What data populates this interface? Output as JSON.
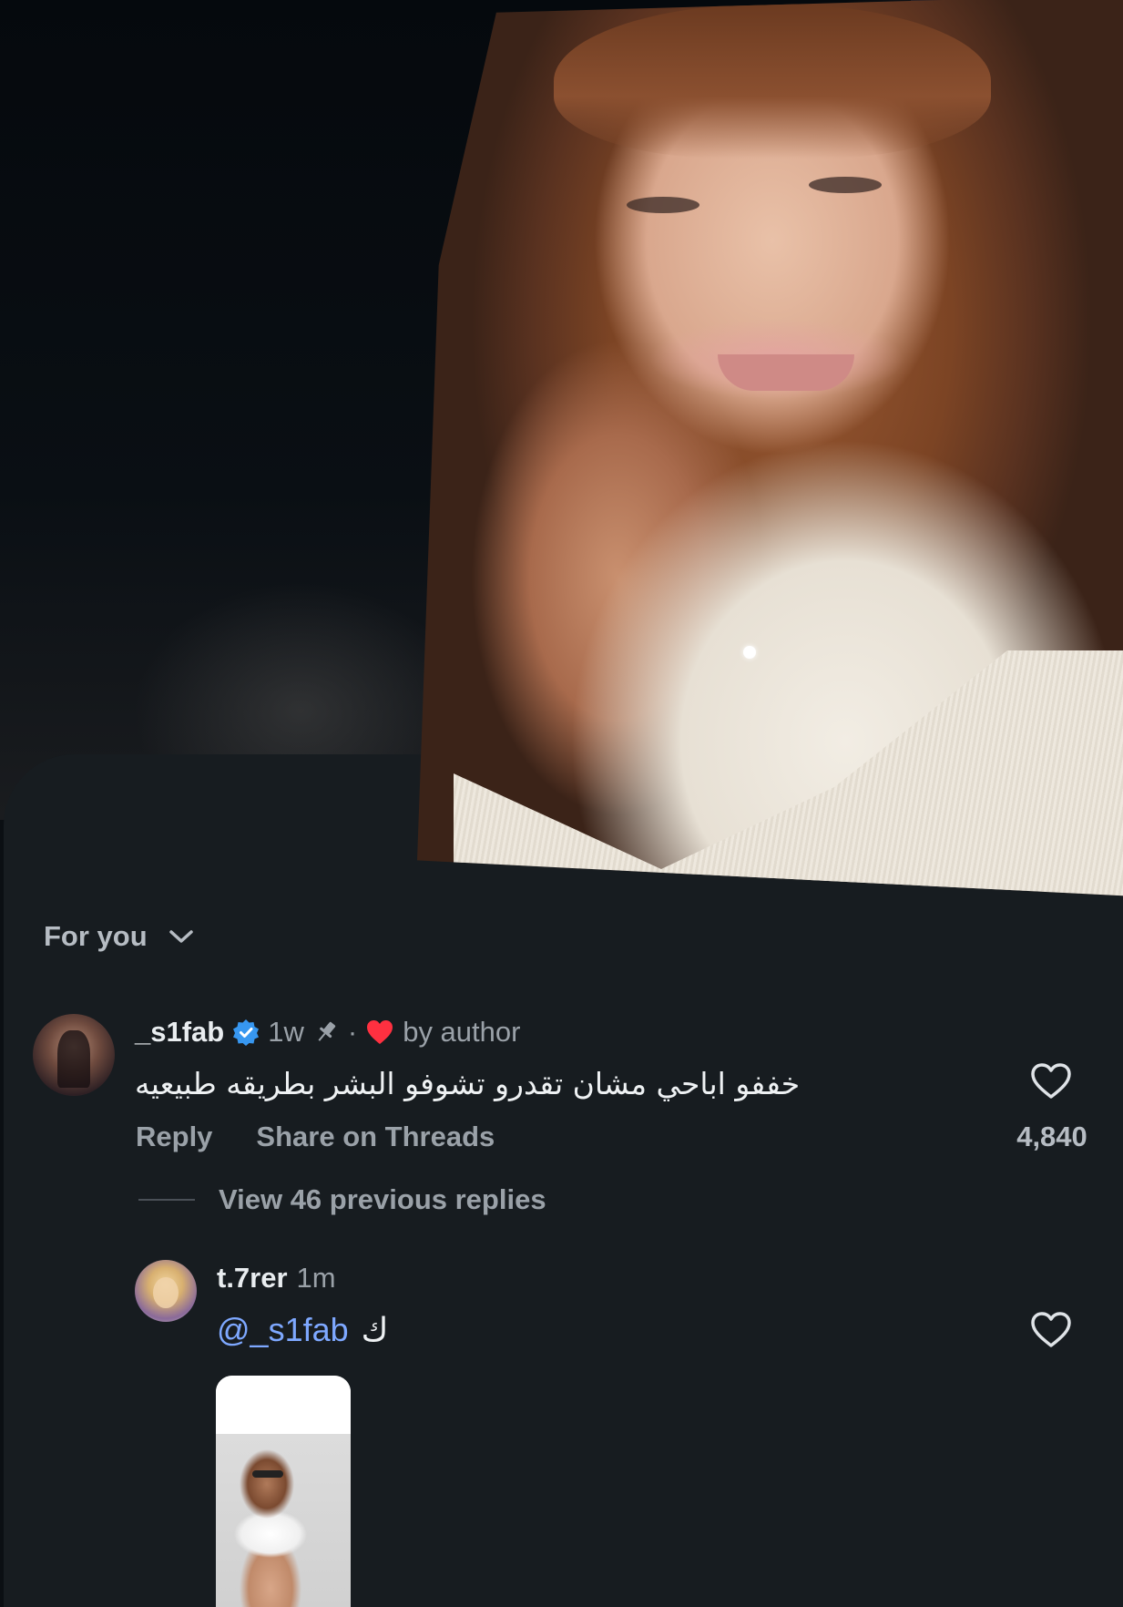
{
  "colors": {
    "sheet": "#171c20",
    "text_primary": "#e9edf0",
    "text_muted": "#9aa1a8",
    "mention": "#7ea8ff",
    "verified": "#3797f0",
    "heart_red": "#ff3040"
  },
  "header": {
    "sort_label": "For you",
    "sort_icon": "chevron-down-icon"
  },
  "comment": {
    "username": "_s1fab",
    "verified_icon": "verified-badge-icon",
    "time": "1w",
    "pin_icon": "pin-icon",
    "separator": "·",
    "liked_by_icon": "heart-filled-icon",
    "liked_by_text": "by author",
    "text": "خففو اباحي مشان تقدرو تشوفو البشر بطريقه طبيعيه",
    "reply_label": "Reply",
    "share_label": "Share on Threads",
    "like_icon": "heart-outline-icon",
    "like_count": "4,840",
    "view_replies_label": "View 46 previous replies"
  },
  "reply": {
    "username": "t.7rer",
    "time": "1m",
    "mention": "@_s1fab",
    "text": "ك",
    "like_icon": "heart-outline-icon"
  }
}
